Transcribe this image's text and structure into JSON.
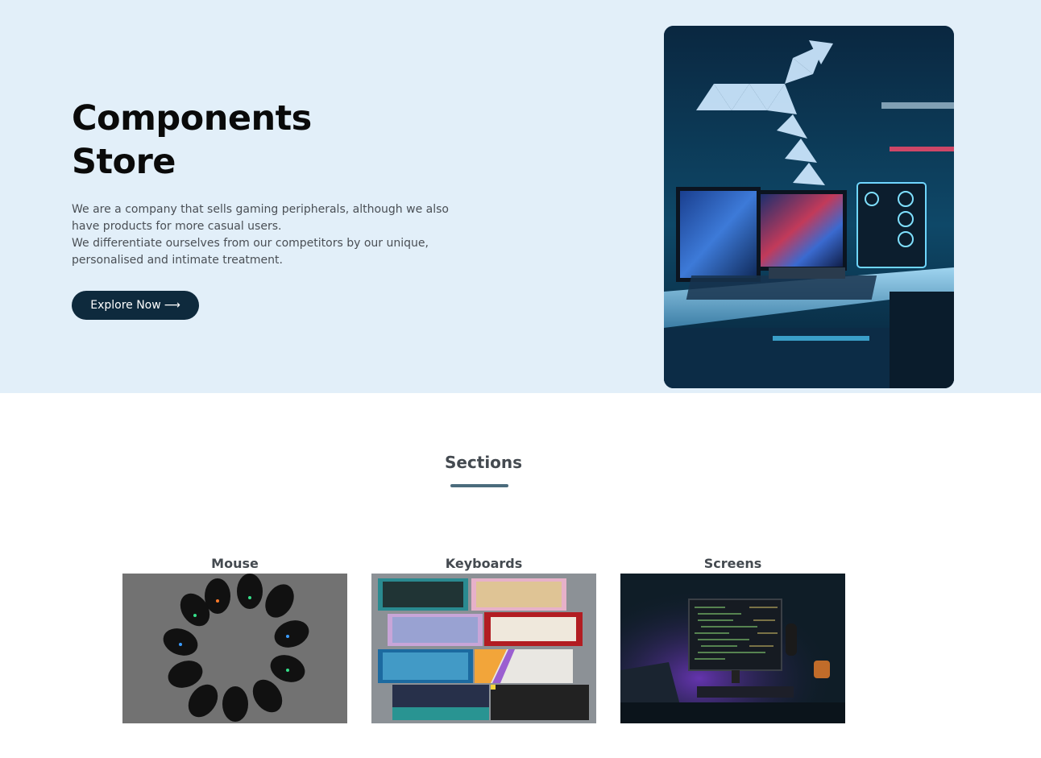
{
  "hero": {
    "title_line1": "Components",
    "title_line2": "Store",
    "desc_line1": "We are a company that sells gaming peripherals, although we also",
    "desc_line2": "have products for more casual users.",
    "desc_line3": "We differentiate ourselves from our competitors by our unique,",
    "desc_line4": "personalised and intimate treatment.",
    "button_label": "Explore Now",
    "button_arrow": "⟶",
    "image_icon": "gaming-setup-photo"
  },
  "sections": {
    "title": "Sections",
    "cards": [
      {
        "label": "Mouse",
        "image": "mouse-collection-photo"
      },
      {
        "label": "Keyboards",
        "image": "keyboard-collection-photo"
      },
      {
        "label": "Screens",
        "image": "monitor-setup-photo"
      }
    ]
  },
  "colors": {
    "hero_bg": "#e2eff9",
    "button_bg": "#0e2a3d",
    "underline": "#4b6b7c"
  }
}
